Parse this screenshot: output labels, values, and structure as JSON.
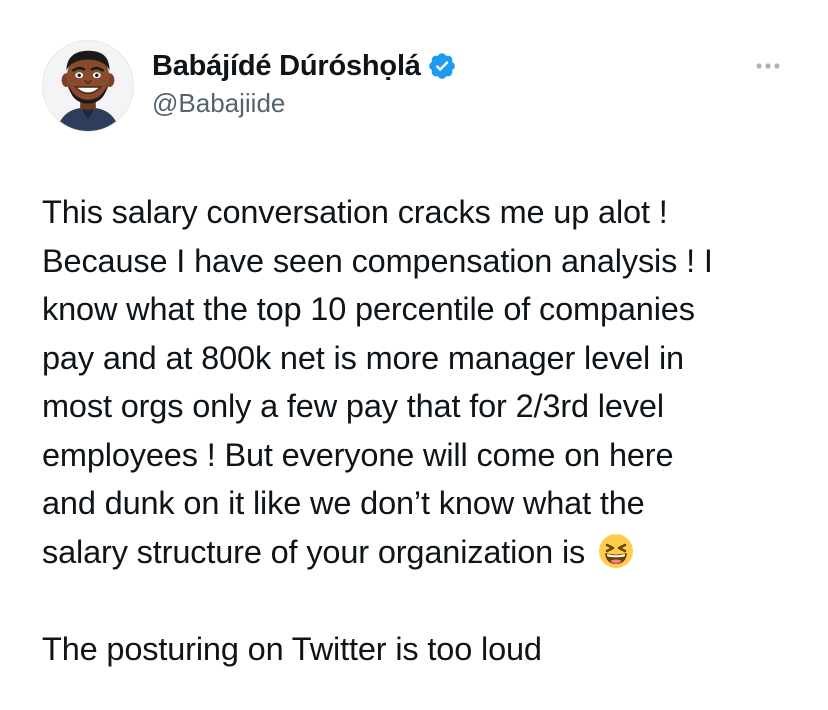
{
  "author": {
    "display_name": "Babájídé Dúróshọlá",
    "handle": "@Babajiide",
    "verified": true
  },
  "icons": {
    "verified_badge": "verified-badge-icon",
    "more_options": "more-horizontal-icon",
    "emoji": "grinning-squinting-face-emoji"
  },
  "colors": {
    "verified_blue": "#1d9bf0",
    "text_primary": "#0f1419",
    "text_secondary": "#536471"
  },
  "tweet": {
    "paragraph1_lines": [
      "This salary conversation cracks me up alot !",
      "Because I have seen compensation analysis ! I",
      "know what the top 10 percentile of companies",
      "pay and at 800k net is more manager level in",
      "most orgs only a few pay that for 2/3rd level",
      "employees ! But everyone will come on here",
      "and dunk on it like we don’t know what the",
      "salary structure of your organization is"
    ],
    "paragraph2": "The posturing on Twitter is too loud"
  }
}
